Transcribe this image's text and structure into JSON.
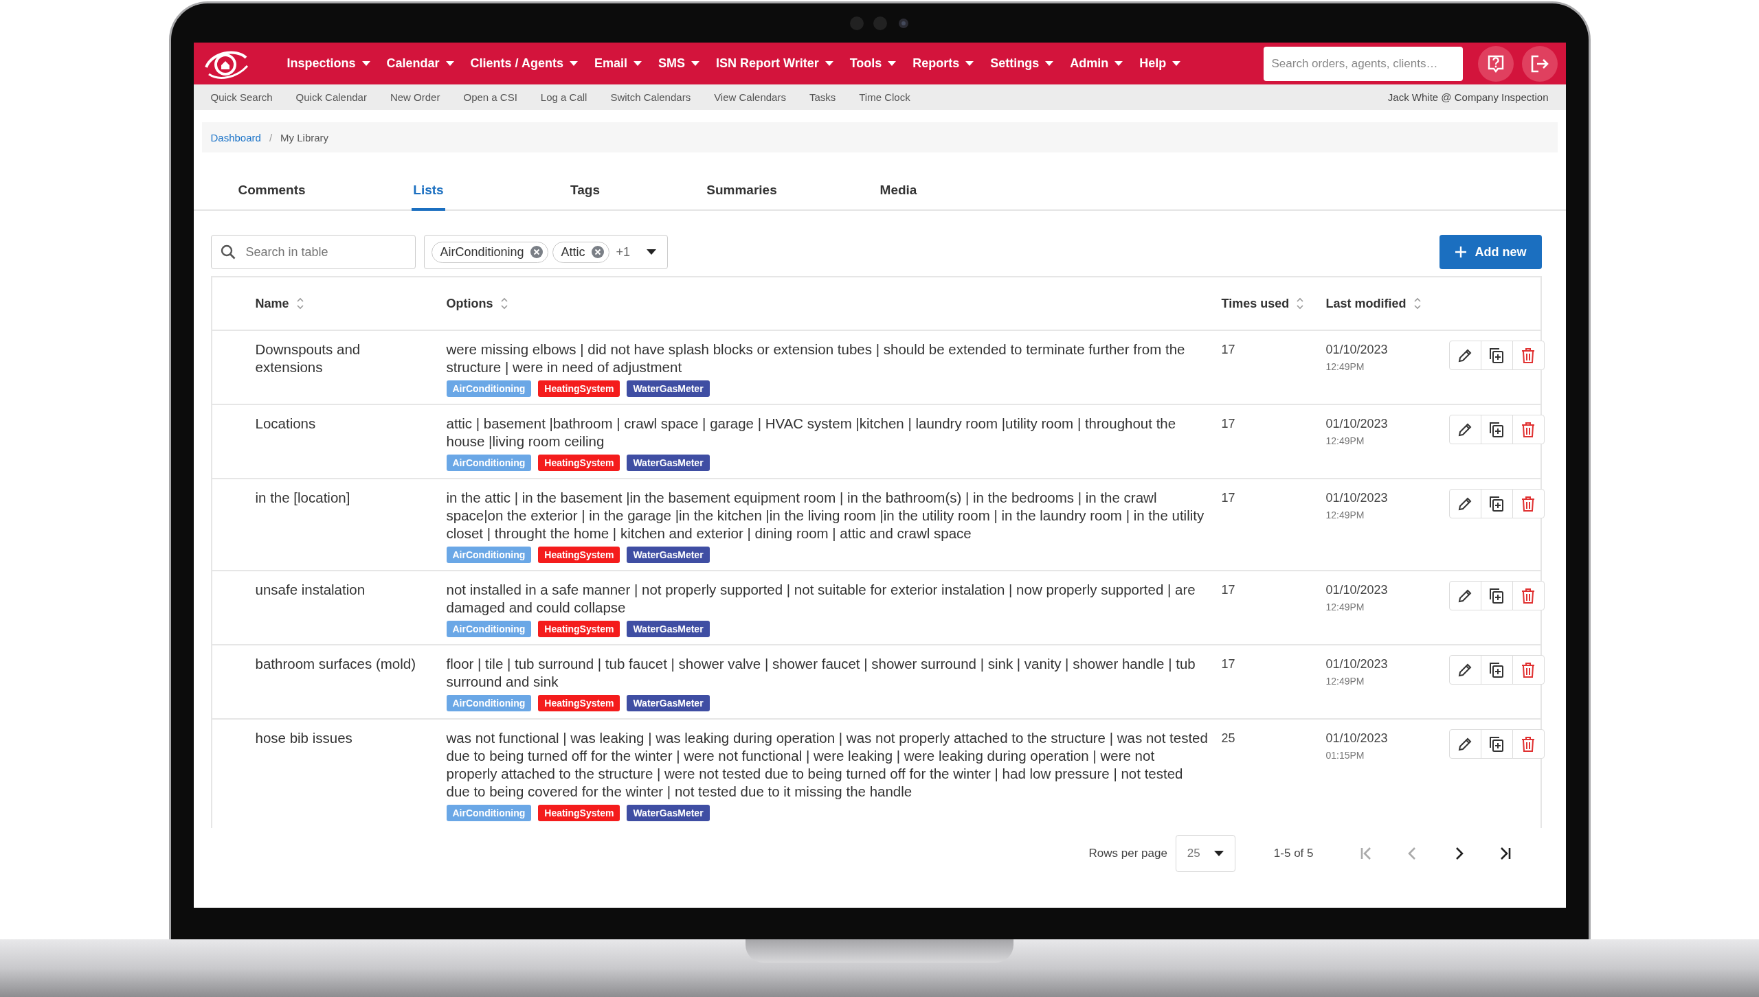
{
  "nav": {
    "menu": [
      "Inspections",
      "Calendar",
      "Clients / Agents",
      "Email",
      "SMS",
      "ISN Report Writer",
      "Tools",
      "Reports",
      "Settings",
      "Admin",
      "Help"
    ],
    "search": {
      "placeholder": "Search orders, agents, clients…"
    }
  },
  "subnav": {
    "links": [
      "Quick Search",
      "Quick Calendar",
      "New Order",
      "Open a CSI",
      "Log a Call",
      "Switch Calendars",
      "View Calendars",
      "Tasks",
      "Time Clock"
    ],
    "user": "Jack White @ Company Inspection"
  },
  "breadcrumb": {
    "separator": "/",
    "items": [
      {
        "label": "Dashboard",
        "link": true
      },
      {
        "label": "My Library",
        "link": false
      }
    ]
  },
  "tabs": [
    {
      "label": "Comments",
      "selected": false
    },
    {
      "label": "Lists",
      "selected": true
    },
    {
      "label": "Tags",
      "selected": false
    },
    {
      "label": "Summaries",
      "selected": false
    },
    {
      "label": "Media",
      "selected": false
    }
  ],
  "toolbar": {
    "search": {
      "placeholder": "Search in table"
    },
    "filter_chips": [
      "AirConditioning",
      "Attic"
    ],
    "more_count": "+1",
    "add_button": "Add new"
  },
  "table": {
    "columns": [
      "Name",
      "Options",
      "Times used",
      "Last modified"
    ],
    "rows": [
      {
        "name": "Downspouts and extensions",
        "options": "were missing elbows | did not have splash blocks or extension tubes | should be extended to terminate further from the structure | were in need of adjustment",
        "tags": [
          {
            "label": "AirConditioning",
            "color": "#6aa7e6"
          },
          {
            "label": "HeatingSystem",
            "color": "#f41c1c"
          },
          {
            "label": "WaterGasMeter",
            "color": "#3f4ea3"
          }
        ],
        "times_used": "17",
        "date": "01/10/2023",
        "time": "12:49PM"
      },
      {
        "name": "Locations",
        "options": "attic | basement |bathroom | crawl space | garage | HVAC system |kitchen | laundry room |utility room | throughout the house |living room ceiling",
        "tags": [
          {
            "label": "AirConditioning",
            "color": "#6aa7e6"
          },
          {
            "label": "HeatingSystem",
            "color": "#f41c1c"
          },
          {
            "label": "WaterGasMeter",
            "color": "#3f4ea3"
          }
        ],
        "times_used": "17",
        "date": "01/10/2023",
        "time": "12:49PM"
      },
      {
        "name": "in the [location]",
        "options": "in the attic | in the basement |in the basement equipment room | in the bathroom(s) | in the bedrooms | in the crawl space|on the exterior | in the garage |in the kitchen |in the living room |in the utility room | in the laundry room | in the utility closet | throught the home | kitchen and exterior | dining room | attic and crawl space",
        "tags": [
          {
            "label": "AirConditioning",
            "color": "#6aa7e6"
          },
          {
            "label": "HeatingSystem",
            "color": "#f41c1c"
          },
          {
            "label": "WaterGasMeter",
            "color": "#3f4ea3"
          }
        ],
        "times_used": "17",
        "date": "01/10/2023",
        "time": "12:49PM"
      },
      {
        "name": "unsafe instalation",
        "options": "not installed in a safe manner | not properly supported | not suitable for exterior instalation | now properly supported | are damaged and could collapse",
        "tags": [
          {
            "label": "AirConditioning",
            "color": "#6aa7e6"
          },
          {
            "label": "HeatingSystem",
            "color": "#f41c1c"
          },
          {
            "label": "WaterGasMeter",
            "color": "#3f4ea3"
          }
        ],
        "times_used": "17",
        "date": "01/10/2023",
        "time": "12:49PM"
      },
      {
        "name": "bathroom surfaces (mold)",
        "options": "floor | tile | tub surround | tub faucet | shower valve | shower faucet | shower surround | sink | vanity | shower handle | tub surround and sink",
        "tags": [
          {
            "label": "AirConditioning",
            "color": "#6aa7e6"
          },
          {
            "label": "HeatingSystem",
            "color": "#f41c1c"
          },
          {
            "label": "WaterGasMeter",
            "color": "#3f4ea3"
          }
        ],
        "times_used": "17",
        "date": "01/10/2023",
        "time": "12:49PM"
      },
      {
        "name": "hose bib issues",
        "options": "was not functional | was leaking | was leaking during operation | was not properly attached to the structure | was not tested due to being turned off for the winter | were not functional | were leaking | were leaking during operation | were not properly attached to the structure | were not tested due to being turned off for the winter | had low pressure | not tested due to being covered for the winter | not tested due to it missing the handle",
        "tags": [
          {
            "label": "AirConditioning",
            "color": "#6aa7e6"
          },
          {
            "label": "HeatingSystem",
            "color": "#f41c1c"
          },
          {
            "label": "WaterGasMeter",
            "color": "#3f4ea3"
          }
        ],
        "times_used": "25",
        "date": "01/10/2023",
        "time": "01:15PM"
      }
    ]
  },
  "pagination": {
    "rows_per_page_label": "Rows per page",
    "rows_per_page": "25",
    "range": "1-5 of 5",
    "buttons": [
      {
        "kind": "first",
        "disabled": true
      },
      {
        "kind": "prev",
        "disabled": true
      },
      {
        "kind": "next",
        "disabled": false
      },
      {
        "kind": "last",
        "disabled": false
      }
    ]
  }
}
